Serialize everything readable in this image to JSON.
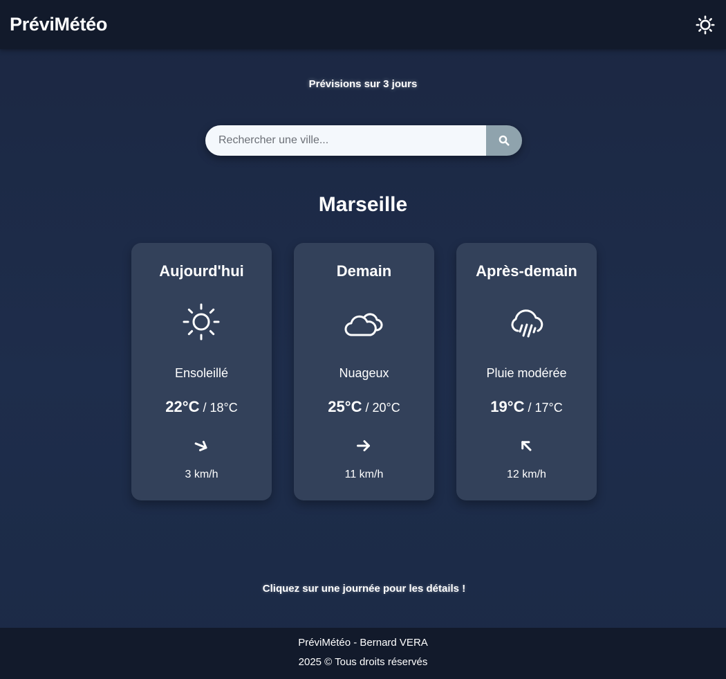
{
  "header": {
    "app_title": "PréviMétéo",
    "theme_toggle_icon": "sun-icon"
  },
  "subtitle": "Prévisions sur 3 jours",
  "search": {
    "placeholder": "Rechercher une ville...",
    "value": "",
    "button_icon": "search-icon"
  },
  "city": "Marseille",
  "forecast": [
    {
      "day": "Aujourd'hui",
      "icon": "sun-icon",
      "condition": "Ensoleillé",
      "temp_max": "22°C",
      "separator": " / ",
      "temp_min": "18°C",
      "wind_direction_icon": "arrow-east-southeast-icon",
      "wind_speed": "3 km/h"
    },
    {
      "day": "Demain",
      "icon": "cloud-icon",
      "condition": "Nuageux",
      "temp_max": "25°C",
      "separator": " / ",
      "temp_min": "20°C",
      "wind_direction_icon": "arrow-east-icon",
      "wind_speed": "11 km/h"
    },
    {
      "day": "Après-demain",
      "icon": "rain-cloud-icon",
      "condition": "Pluie modérée",
      "temp_max": "19°C",
      "separator": " / ",
      "temp_min": "17°C",
      "wind_direction_icon": "arrow-northwest-icon",
      "wind_speed": "12 km/h"
    }
  ],
  "hint": "Cliquez sur une journée pour les détails !",
  "footer": {
    "line1": "PréviMétéo - Bernard VERA",
    "line2": "2025 © Tous droits réservés"
  },
  "colors": {
    "header_bg": "#121a2b",
    "page_bg": "#1e2d4b",
    "card_bg": "#33415a",
    "search_button_bg": "#8fa3ad",
    "search_input_bg": "#f4f8fc"
  }
}
